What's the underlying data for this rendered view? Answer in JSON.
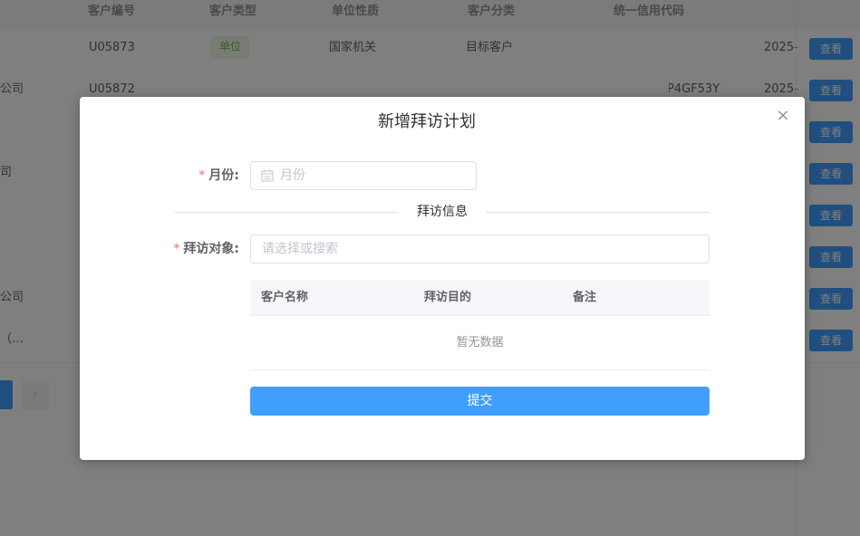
{
  "background_table": {
    "headers": [
      "客户编号",
      "客户类型",
      "单位性质",
      "客户分类",
      "统一信用代码"
    ],
    "rows": [
      {
        "name": "",
        "code": "U05873",
        "type_tag": "单位",
        "nature": "国家机关",
        "category": "目标客户",
        "credit": "",
        "date": "2025-",
        "action": "查看"
      },
      {
        "name": "公司",
        "code": "U05872",
        "type_tag": "",
        "nature": "",
        "category": "",
        "credit": "P4GF53Y",
        "date": "2025-",
        "action": "查看"
      },
      {
        "name": "",
        "code": "",
        "type_tag": "",
        "nature": "",
        "category": "",
        "credit": "",
        "date": "",
        "action": "查看"
      },
      {
        "name": "司",
        "code": "",
        "type_tag": "",
        "nature": "",
        "category": "",
        "credit": "",
        "date": "",
        "action": "查看"
      },
      {
        "name": "",
        "code": "",
        "type_tag": "",
        "nature": "",
        "category": "",
        "credit": "",
        "date": "",
        "action": "查看"
      },
      {
        "name": "",
        "code": "",
        "type_tag": "",
        "nature": "",
        "category": "",
        "credit": "",
        "date": "",
        "action": "查看"
      },
      {
        "name": "公司",
        "code": "",
        "type_tag": "",
        "nature": "",
        "category": "",
        "credit": "",
        "date": "",
        "action": "查看"
      },
      {
        "name": "（…",
        "code": "",
        "type_tag": "",
        "nature": "",
        "category": "",
        "credit": "",
        "date": "",
        "action": "查看"
      }
    ],
    "pager_next": "›"
  },
  "dialog": {
    "title": "新增拜访计划",
    "close_icon": "×",
    "month_label": "月份:",
    "month_placeholder": "月份",
    "required_mark": "*",
    "section_title": "拜访信息",
    "target_label": "拜访对象:",
    "target_placeholder": "请选择或搜索",
    "table": {
      "columns": [
        "客户名称",
        "拜访目的",
        "备注"
      ],
      "empty_text": "暂无数据"
    },
    "submit_label": "提交"
  },
  "colors": {
    "primary": "#409eff",
    "required": "#f56c6c",
    "overlay": "rgba(0,0,0,0.5)"
  }
}
